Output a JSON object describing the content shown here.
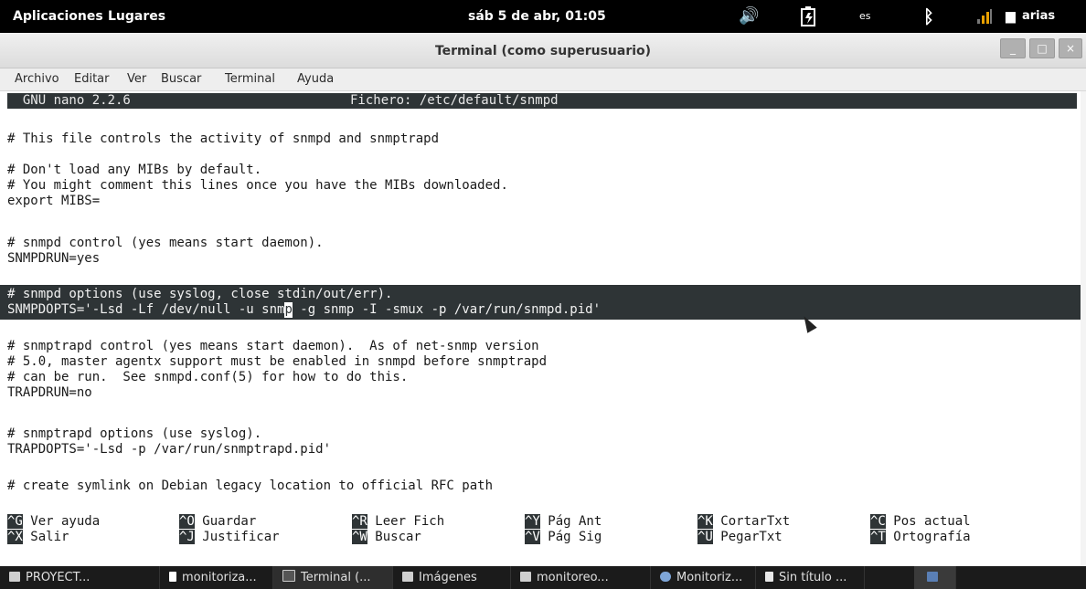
{
  "panel": {
    "applications": "Aplicaciones",
    "places": "Lugares",
    "clock": "sáb  5 de abr, 01:05",
    "keyboard": "es",
    "user": "arias"
  },
  "window": {
    "title": "Terminal (como superusuario)",
    "minimize": "_",
    "maximize": "□",
    "close": "×"
  },
  "menubar": [
    "Archivo",
    "Editar",
    "Ver",
    "Buscar",
    "Terminal",
    "Ayuda"
  ],
  "nano": {
    "version": "  GNU nano 2.2.6",
    "file": "Fichero: /etc/default/snmpd"
  },
  "file_lines": [
    "# This file controls the activity of snmpd and snmptrapd",
    "",
    "# Don't load any MIBs by default.",
    "# You might comment this lines once you have the MIBs downloaded.",
    "export MIBS=",
    "",
    "# snmpd control (yes means start daemon).",
    "SNMPDRUN=yes",
    "",
    "# snmpd options (use syslog, close stdin/out/err).",
    "SNMPDOPTS='-Lsd -Lf /dev/null -u snmp -g snmp -I -smux -p /var/run/snmpd.pid'",
    "",
    "# snmptrapd control (yes means start daemon).  As of net-snmp version",
    "# 5.0, master agentx support must be enabled in snmpd before snmptrapd",
    "# can be run.  See snmpd.conf(5) for how to do this.",
    "TRAPDRUN=no",
    "",
    "# snmptrapd options (use syslog).",
    "TRAPDOPTS='-Lsd -p /var/run/snmptrapd.pid'",
    "",
    "# create symlink on Debian legacy location to official RFC path"
  ],
  "highlight": {
    "line1": "# snmpd options (use syslog, close stdin/out/err).",
    "line2_before": "SNMPDOPTS='-Lsd -Lf /dev/null -u snm",
    "line2_cursor": "p",
    "line2_after": " -g snmp -I -smux -p /var/run/snmpd.pid'"
  },
  "shortcuts": [
    [
      {
        "key": "^G",
        "label": " Ver ayuda"
      },
      {
        "key": "^O",
        "label": " Guardar"
      },
      {
        "key": "^R",
        "label": " Leer Fich"
      },
      {
        "key": "^Y",
        "label": " Pág Ant"
      },
      {
        "key": "^K",
        "label": " CortarTxt"
      },
      {
        "key": "^C",
        "label": " Pos actual"
      }
    ],
    [
      {
        "key": "^X",
        "label": " Salir"
      },
      {
        "key": "^J",
        "label": " Justificar"
      },
      {
        "key": "^W",
        "label": " Buscar"
      },
      {
        "key": "^V",
        "label": " Pág Sig"
      },
      {
        "key": "^U",
        "label": " PegarTxt"
      },
      {
        "key": "^T",
        "label": " Ortografía"
      }
    ]
  ],
  "taskbar": [
    "PROYECT...",
    "monitoriza...",
    "Terminal (...",
    "Imágenes",
    "monitoreo...",
    "Monitoriz...",
    "Sin título ...",
    ""
  ]
}
